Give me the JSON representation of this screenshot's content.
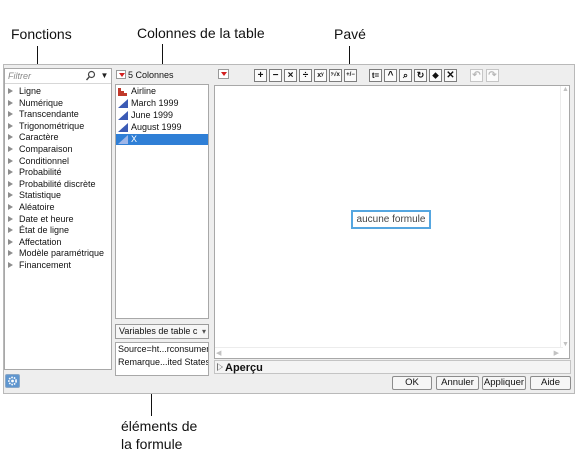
{
  "annotations": {
    "functions": "Fonctions",
    "columns": "Colonnes de la table",
    "keypad": "Pavé",
    "elements_line1": "éléments de",
    "elements_line2": "la formule"
  },
  "functions_panel": {
    "filter_placeholder": "Filtrer",
    "search_icon": "search-icon",
    "categories": [
      "Ligne",
      "Numérique",
      "Transcendante",
      "Trigonométrique",
      "Caractère",
      "Comparaison",
      "Conditionnel",
      "Probabilité",
      "Probabilité discrète",
      "Statistique",
      "Aléatoire",
      "Date et heure",
      "État de ligne",
      "Affectation",
      "Modèle paramétrique",
      "Financement"
    ]
  },
  "columns_panel": {
    "header": "5 Colonnes",
    "columns": [
      {
        "name": "Airline",
        "icon": "nominal-bar-icon",
        "color": "#c0392b"
      },
      {
        "name": "March 1999",
        "icon": "continuous-triangle-icon",
        "color": "#3b5bb5"
      },
      {
        "name": "June 1999",
        "icon": "continuous-triangle-icon",
        "color": "#3b5bb5"
      },
      {
        "name": "August 1999",
        "icon": "continuous-triangle-icon",
        "color": "#3b5bb5"
      },
      {
        "name": "X",
        "icon": "continuous-triangle-icon",
        "color": "#3b5bb5",
        "selected": true
      }
    ],
    "selection_color": "#2f7fd6"
  },
  "variables": {
    "select_label": "Variables de table c",
    "items": [
      "Source=ht...rconsumer/",
      "Remarque...ited States."
    ]
  },
  "toolbar": {
    "buttons": [
      {
        "glyph": "+",
        "name": "add-icon"
      },
      {
        "glyph": "−",
        "name": "subtract-icon"
      },
      {
        "glyph": "×",
        "name": "multiply-icon"
      },
      {
        "glyph": "÷",
        "name": "divide-icon"
      },
      {
        "glyph": "xʸ",
        "name": "power-icon"
      },
      {
        "glyph": "ʸ√x",
        "name": "root-icon"
      },
      {
        "glyph": "+/−",
        "name": "change-sign-icon"
      },
      {
        "glyph": "t=",
        "name": "assign-icon"
      },
      {
        "glyph": "^",
        "name": "raise-icon"
      },
      {
        "glyph": "⌕",
        "name": "local-variable-icon"
      },
      {
        "glyph": "↻",
        "name": "swap-icon"
      },
      {
        "glyph": "⬥",
        "name": "peel-icon"
      },
      {
        "glyph": "✕",
        "name": "delete-icon"
      },
      {
        "glyph": "↶",
        "name": "undo-icon",
        "disabled": true
      },
      {
        "glyph": "↷",
        "name": "redo-icon",
        "disabled": true
      }
    ]
  },
  "editor": {
    "empty_text": "aucune formule",
    "accent_color": "#55a6e0"
  },
  "preview": {
    "label": "Aperçu"
  },
  "buttons": {
    "ok": "OK",
    "cancel": "Annuler",
    "apply": "Appliquer",
    "help": "Aide"
  }
}
